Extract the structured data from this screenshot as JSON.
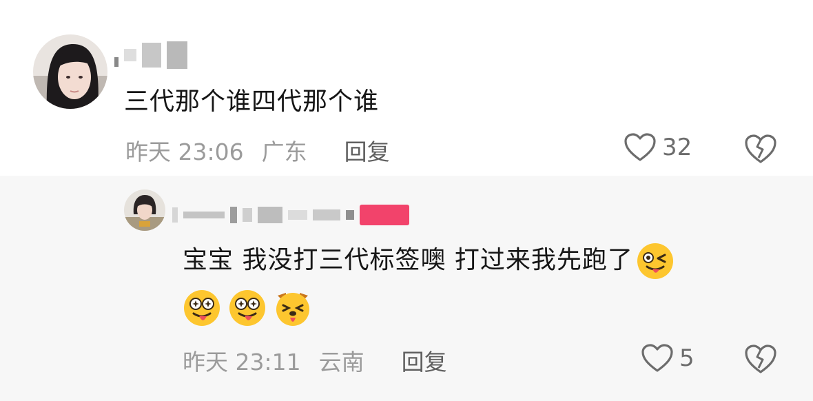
{
  "comments": [
    {
      "text": "三代那个谁四代那个谁",
      "time": "昨天 23:06",
      "location": "广东",
      "reply_label": "回复",
      "likes": "32"
    },
    {
      "text": "宝宝 我没打三代标签噢 打过来我先跑了",
      "time": "昨天 23:11",
      "location": "云南",
      "reply_label": "回复",
      "likes": "5"
    }
  ],
  "icons": {
    "like": "heart-outline-icon",
    "dislike": "broken-heart-icon"
  },
  "colors": {
    "text": "#161616",
    "meta": "#9b9b9b",
    "reply": "#5f5f5f",
    "reply_bg": "#f7f7f7",
    "emoji_yellow": "#fdc62f",
    "name_tag_pink": "#f2436b"
  }
}
